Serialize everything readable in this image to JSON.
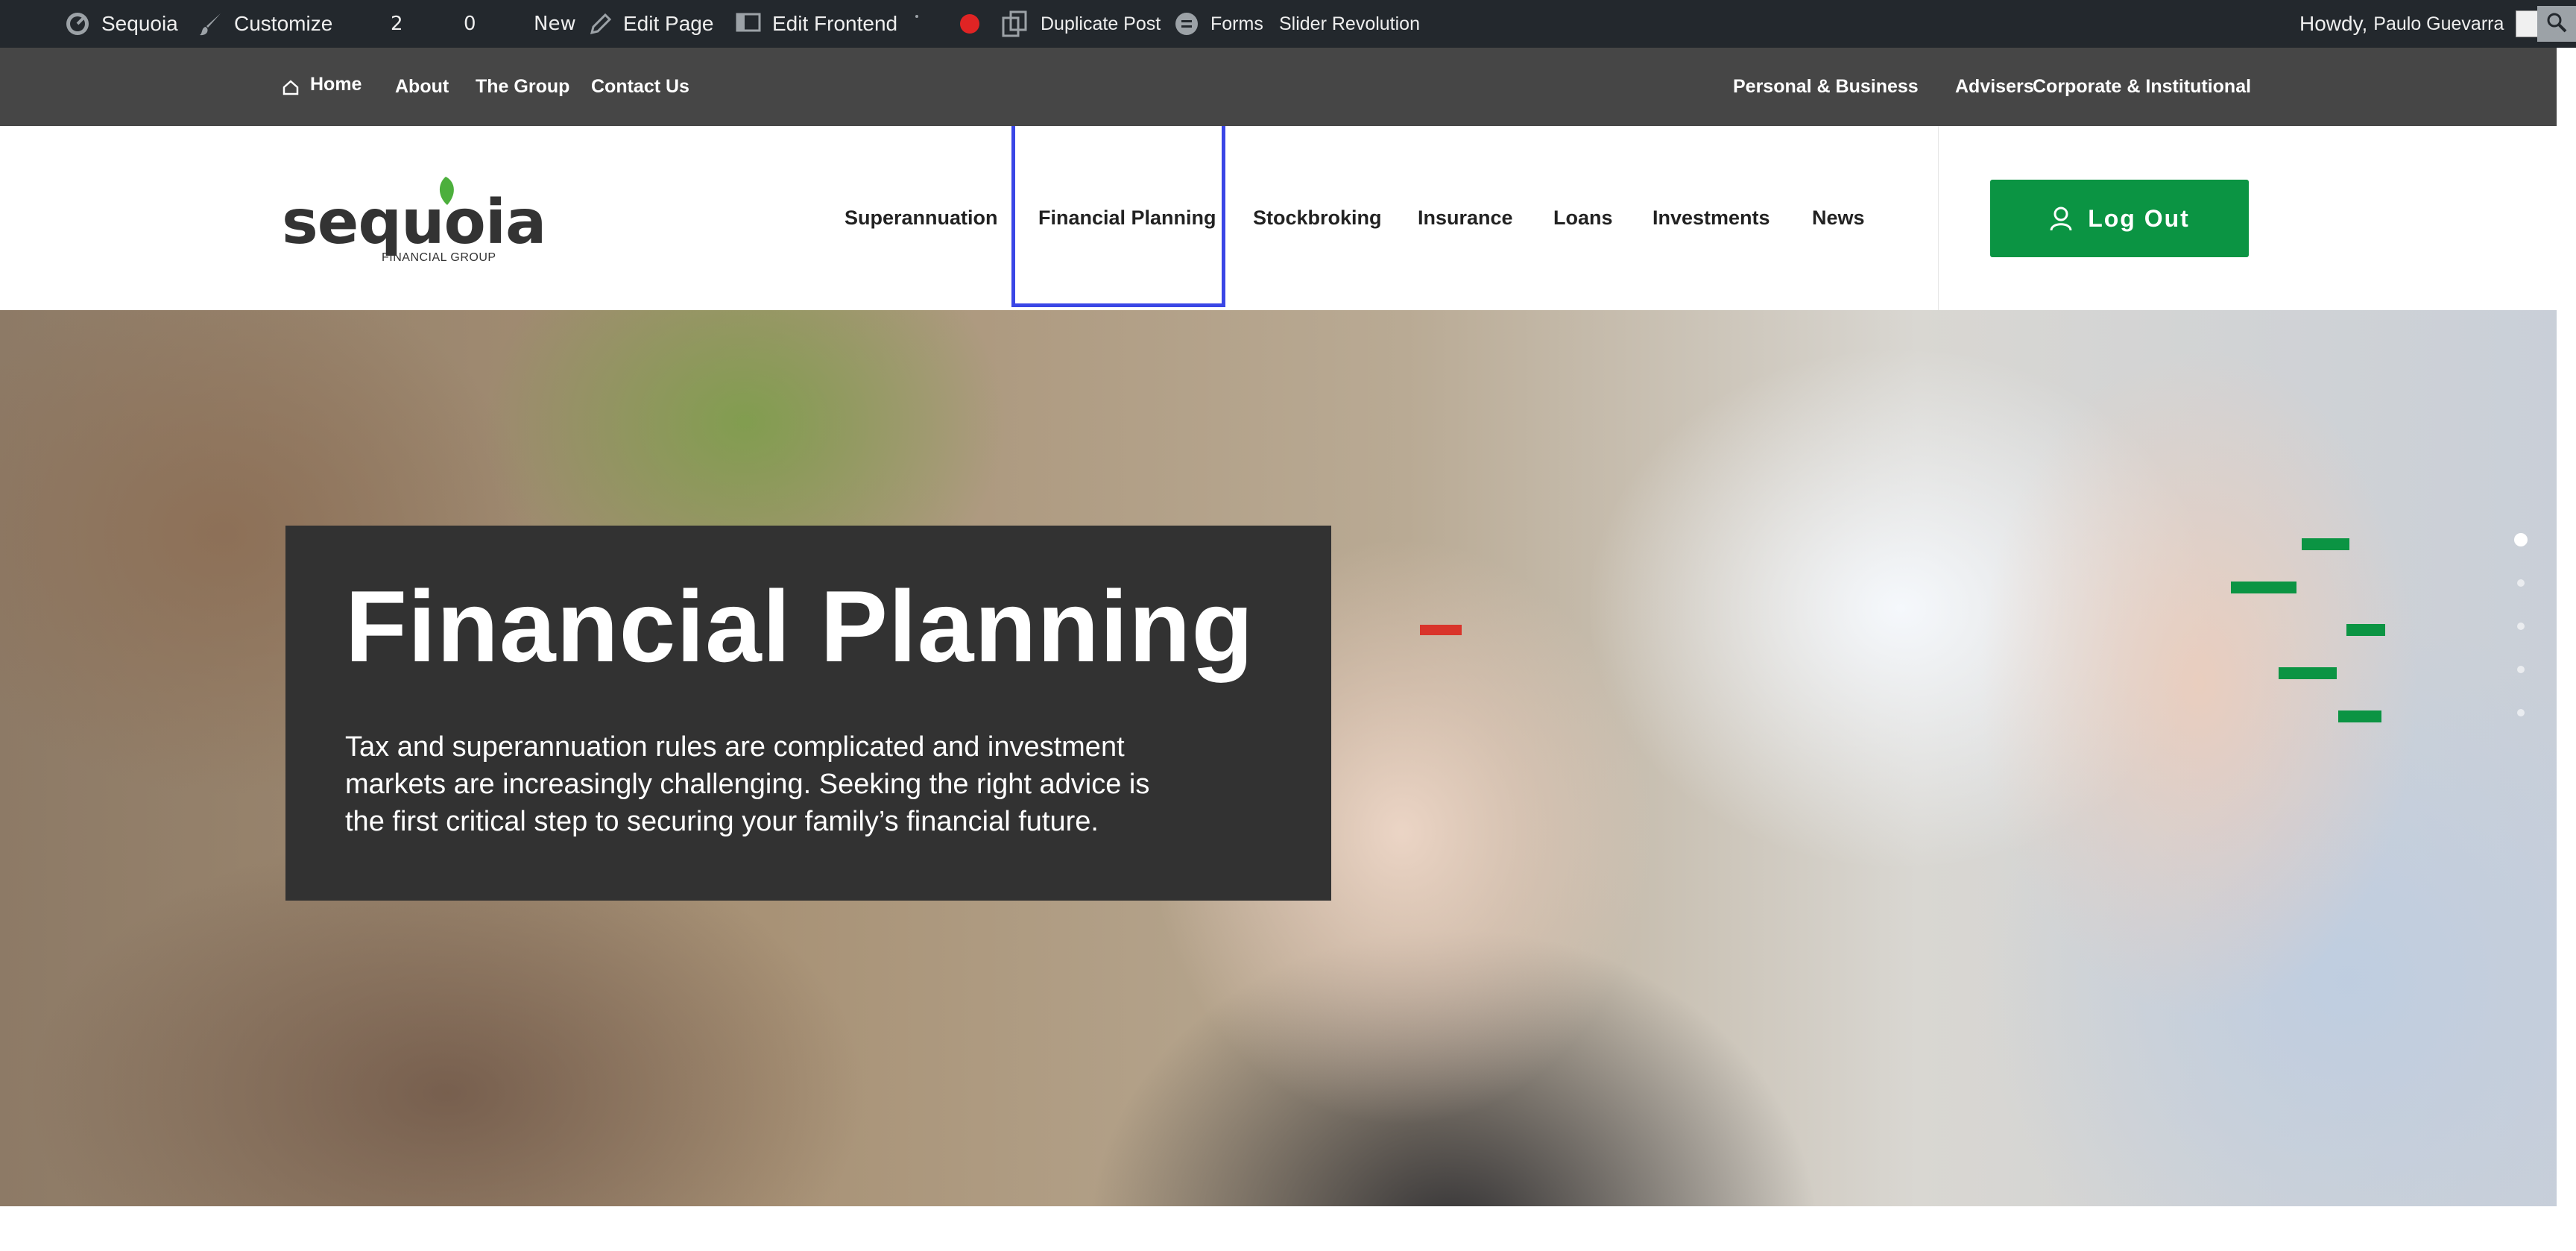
{
  "adminbar": {
    "site_name": "Sequoia",
    "customize": "Customize",
    "updates_count": "2",
    "comments_count": "0",
    "new": "New",
    "edit_page": "Edit Page",
    "edit_frontend": "Edit Frontend",
    "duplicate_post": "Duplicate Post",
    "forms": "Forms",
    "slider_revolution": "Slider Revolution",
    "howdy": "Howdy,",
    "user_name": "Paulo Guevarra"
  },
  "utility_nav": {
    "left": [
      "Home",
      "About",
      "The Group",
      "Contact Us"
    ],
    "right": [
      "Personal & Business",
      "Advisers",
      "Corporate & Institutional"
    ]
  },
  "logo": {
    "wordmark": "sequoia",
    "tagline": "FINANCIAL GROUP"
  },
  "main_nav": {
    "items": [
      "Superannuation",
      "Financial Planning",
      "Stockbroking",
      "Insurance",
      "Loans",
      "Investments",
      "News"
    ],
    "active": "Financial Planning",
    "logout": "Log Out"
  },
  "hero": {
    "title": "Financial Planning",
    "text": "Tax and superannuation rules are complicated and investment markets are increasingly challenging. Seeking the right advice is the first critical step to securing your family’s financial future."
  },
  "colors": {
    "adminbar_bg": "#23282d",
    "utilbar_bg": "#464646",
    "brand_green": "#0b9443",
    "hero_box_bg": "#323232",
    "active_outline": "#3a46e6"
  },
  "slider": {
    "slides": 5,
    "active": 1
  }
}
